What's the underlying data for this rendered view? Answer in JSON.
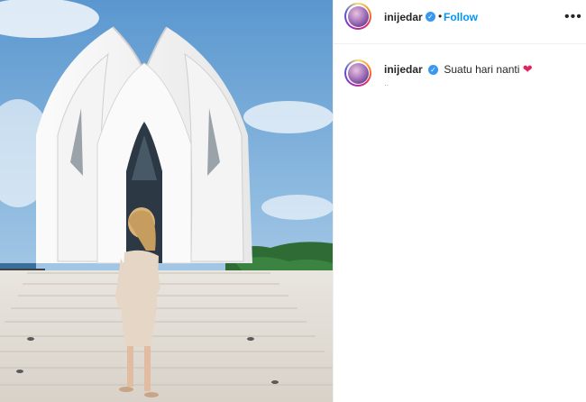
{
  "post": {
    "username": "inijedar",
    "verified_symbol": "✓",
    "separator": "•",
    "follow_label": "Follow",
    "more_label": "•••",
    "caption_text": "Suatu hari nanti",
    "caption_emoji": "❤",
    "timestamp": "··"
  },
  "colors": {
    "accent_blue": "#0095f6",
    "verified_blue": "#3897f0",
    "heart_red": "#e0245e"
  }
}
